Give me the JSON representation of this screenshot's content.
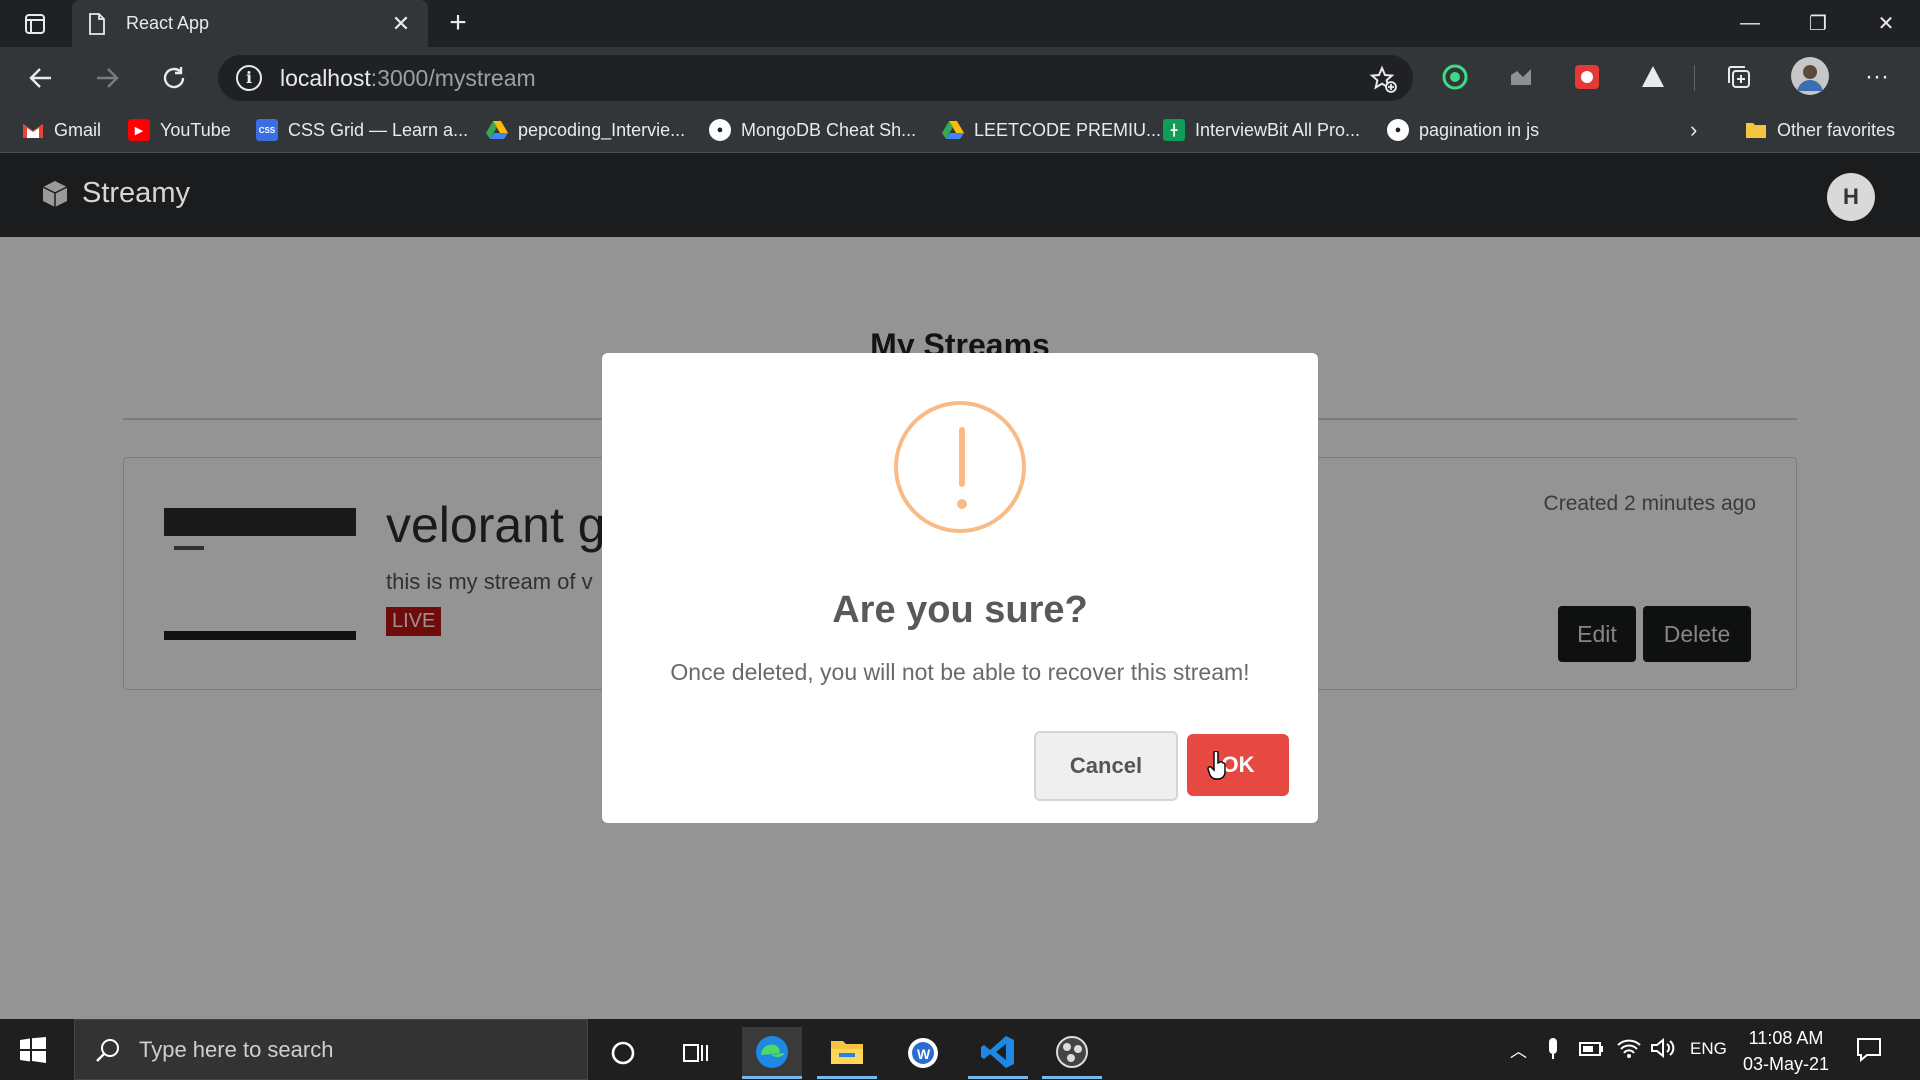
{
  "browser": {
    "tab_title": "React App",
    "url_host": "localhost",
    "url_path": ":3000/mystream",
    "bookmarks": [
      {
        "label": "Gmail",
        "color": "#ea4335",
        "icon": "gmail-icon"
      },
      {
        "label": "YouTube",
        "color": "#ff0000",
        "icon": "youtube-icon"
      },
      {
        "label": "CSS Grid — Learn a...",
        "color": "#3b6ee0",
        "icon": "css-grid-icon"
      },
      {
        "label": "pepcoding_Intervie...",
        "color": "#34a853",
        "icon": "google-drive-icon"
      },
      {
        "label": "MongoDB Cheat Sh...",
        "color": "#ffffff",
        "icon": "github-icon"
      },
      {
        "label": "LEETCODE PREMIU...",
        "color": "#34a853",
        "icon": "google-drive-icon"
      },
      {
        "label": "InterviewBit All Pro...",
        "color": "#0f9d58",
        "icon": "google-sheets-icon"
      },
      {
        "label": "pagination in js",
        "color": "#ffffff",
        "icon": "github-icon"
      }
    ],
    "other_favorites": "Other favorites"
  },
  "app": {
    "brand": "Streamy",
    "user_initial": "H",
    "page_title": "My Streams",
    "stream": {
      "title": "velorant g",
      "description": "this is my stream of v",
      "live_label": "LIVE",
      "created": "Created 2 minutes ago",
      "edit_label": "Edit",
      "delete_label": "Delete"
    }
  },
  "modal": {
    "title": "Are you sure?",
    "text": "Once deleted, you will not be able to recover this stream!",
    "cancel_label": "Cancel",
    "ok_label": "OK",
    "accent_color": "#e64942",
    "warning_color": "#f8bb86"
  },
  "taskbar": {
    "search_placeholder": "Type here to search",
    "language": "ENG",
    "time": "11:08 AM",
    "date": "03-May-21"
  }
}
